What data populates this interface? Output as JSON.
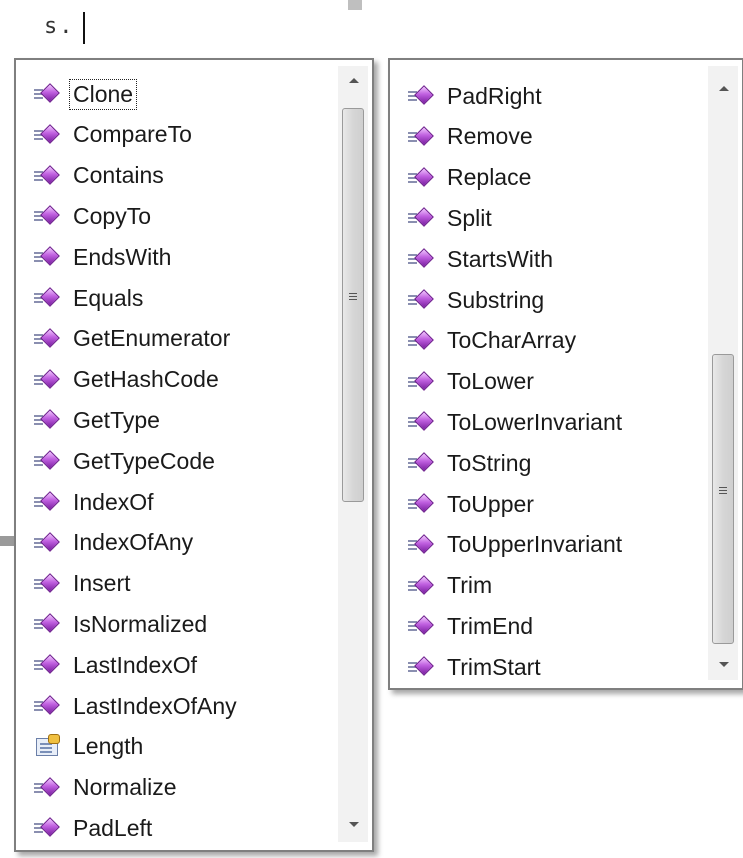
{
  "editor": {
    "text": "s."
  },
  "left_list": {
    "selected_index": 0,
    "items": [
      {
        "label": "Clone",
        "icon": "method-icon"
      },
      {
        "label": "CompareTo",
        "icon": "method-icon"
      },
      {
        "label": "Contains",
        "icon": "method-icon"
      },
      {
        "label": "CopyTo",
        "icon": "method-icon"
      },
      {
        "label": "EndsWith",
        "icon": "method-icon"
      },
      {
        "label": "Equals",
        "icon": "method-icon"
      },
      {
        "label": "GetEnumerator",
        "icon": "method-icon"
      },
      {
        "label": "GetHashCode",
        "icon": "method-icon"
      },
      {
        "label": "GetType",
        "icon": "method-icon"
      },
      {
        "label": "GetTypeCode",
        "icon": "method-icon"
      },
      {
        "label": "IndexOf",
        "icon": "method-icon"
      },
      {
        "label": "IndexOfAny",
        "icon": "method-icon"
      },
      {
        "label": "Insert",
        "icon": "method-icon"
      },
      {
        "label": "IsNormalized",
        "icon": "method-icon"
      },
      {
        "label": "LastIndexOf",
        "icon": "method-icon"
      },
      {
        "label": "LastIndexOfAny",
        "icon": "method-icon"
      },
      {
        "label": "Length",
        "icon": "property-icon"
      },
      {
        "label": "Normalize",
        "icon": "method-icon"
      },
      {
        "label": "PadLeft",
        "icon": "method-icon"
      }
    ]
  },
  "right_list": {
    "items": [
      {
        "label": "PadRight",
        "icon": "method-icon"
      },
      {
        "label": "Remove",
        "icon": "method-icon"
      },
      {
        "label": "Replace",
        "icon": "method-icon"
      },
      {
        "label": "Split",
        "icon": "method-icon"
      },
      {
        "label": "StartsWith",
        "icon": "method-icon"
      },
      {
        "label": "Substring",
        "icon": "method-icon"
      },
      {
        "label": "ToCharArray",
        "icon": "method-icon"
      },
      {
        "label": "ToLower",
        "icon": "method-icon"
      },
      {
        "label": "ToLowerInvariant",
        "icon": "method-icon"
      },
      {
        "label": "ToString",
        "icon": "method-icon"
      },
      {
        "label": "ToUpper",
        "icon": "method-icon"
      },
      {
        "label": "ToUpperInvariant",
        "icon": "method-icon"
      },
      {
        "label": "Trim",
        "icon": "method-icon"
      },
      {
        "label": "TrimEnd",
        "icon": "method-icon"
      },
      {
        "label": "TrimStart",
        "icon": "method-icon"
      }
    ]
  }
}
